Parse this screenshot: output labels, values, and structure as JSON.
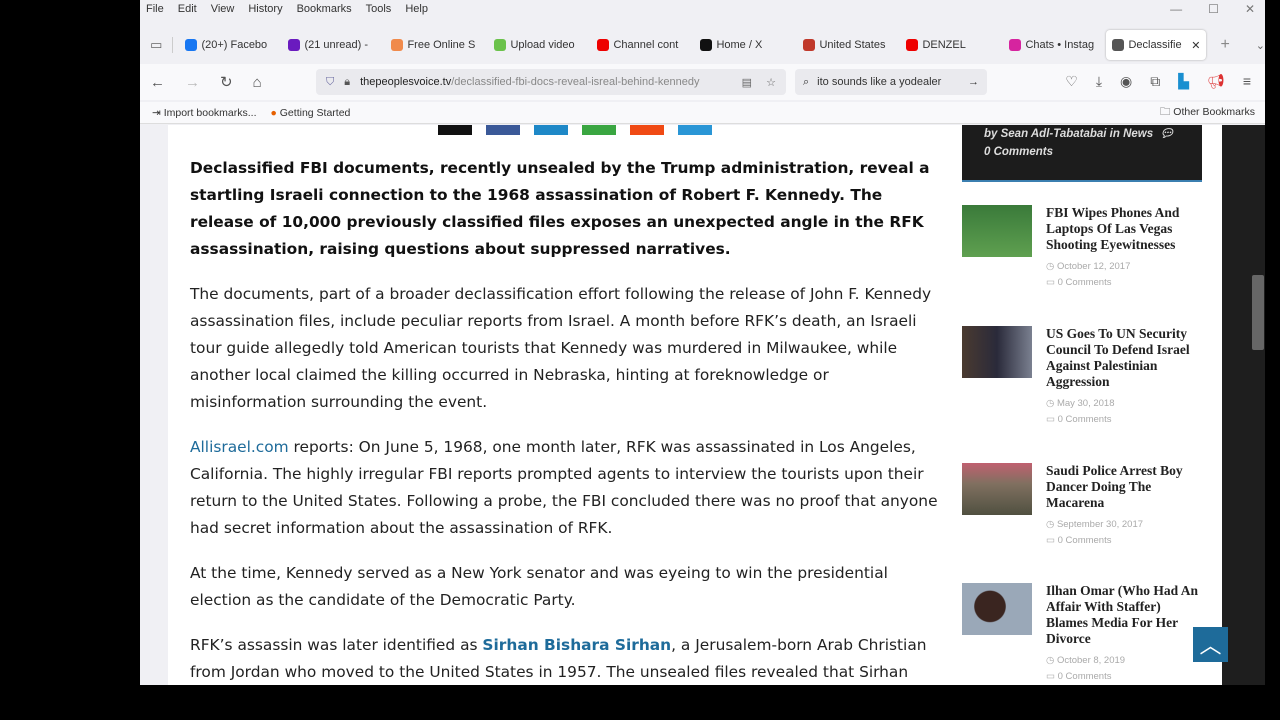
{
  "menu": [
    "File",
    "Edit",
    "View",
    "History",
    "Bookmarks",
    "Tools",
    "Help"
  ],
  "tabs": [
    {
      "label": "(20+) Facebo",
      "color": "#1877f2"
    },
    {
      "label": "(21 unread) -",
      "color": "#6a1bbf"
    },
    {
      "label": "Free Online S",
      "color": "#f08a4b"
    },
    {
      "label": "Upload video",
      "color": "#6bc24b"
    },
    {
      "label": "Channel cont",
      "color": "#e00"
    },
    {
      "label": "Home / X",
      "color": "#111"
    },
    {
      "label": "United States",
      "color": "#c0392b"
    },
    {
      "label": "DENZEL",
      "color": "#e00"
    },
    {
      "label": "Chats • Instag",
      "color": "#d6249f"
    },
    {
      "label": "Declassifie",
      "color": "#555",
      "active": true
    }
  ],
  "url": {
    "domain": "thepeoplesvoice.tv",
    "path": "/declassified-fbi-docs-reveal-isreal-behind-kennedy"
  },
  "search": {
    "value": "ito  sounds like a yodealer"
  },
  "bookmarks": {
    "import": "Import bookmarks...",
    "getting_started": "Getting Started",
    "other": "Other Bookmarks"
  },
  "article": {
    "lead": "Declassified FBI documents, recently unsealed by the Trump administration, reveal a startling Israeli connection to the 1968 assassination of Robert F. Kennedy. The release of 10,000 previously classified files exposes an unexpected angle in the RFK assassination, raising questions about suppressed narratives.",
    "p1": "The documents, part of a broader declassification effort following the release of John F. Kennedy assassination files, include peculiar reports from Israel. A month before RFK’s death, an Israeli tour guide allegedly told American tourists that Kennedy was murdered in Milwaukee, while another local claimed the killing occurred in Nebraska, hinting at foreknowledge or misinformation surrounding the event.",
    "p2_link": "Allisrael.com",
    "p2": " reports: On June 5, 1968, one month later, RFK was assassinated in Los Angeles, California. The highly irregular FBI reports prompted agents to interview the tourists upon their return to the United States. Following a probe, the FBI concluded there was no proof that anyone had secret information about the assassination of RFK.",
    "p3": "At the time, Kennedy served as a New York senator and was eyeing to win the presidential election as the candidate of the Democratic Party.",
    "p4_a": "RFK’s assassin was later identified as ",
    "p4_link": "Sirhan Bishara Sirhan",
    "p4_b": ", a Jerusalem-born Arab Christian from Jordan who moved to the United States in 1957. The unsealed files revealed that Sirhan"
  },
  "sidebar": {
    "meta": "by Sean Adl-Tabatabai in News",
    "meta_comments": "0 Comments",
    "posts": [
      {
        "title": "FBI Wipes Phones And Laptops Of Las Vegas Shooting Eyewitnesses",
        "date": "October 12, 2017",
        "comments": "0 Comments"
      },
      {
        "title": "US Goes To UN Security Council To Defend Israel Against Palestinian Aggression",
        "date": "May 30, 2018",
        "comments": "0 Comments"
      },
      {
        "title": "Saudi Police Arrest Boy Dancer Doing The Macarena",
        "date": "September 30, 2017",
        "comments": "0 Comments"
      },
      {
        "title": "Ilhan Omar (Who Had An Affair With Staffer) Blames Media For Her Divorce",
        "date": "October 8, 2019",
        "comments": "0 Comments"
      }
    ]
  }
}
